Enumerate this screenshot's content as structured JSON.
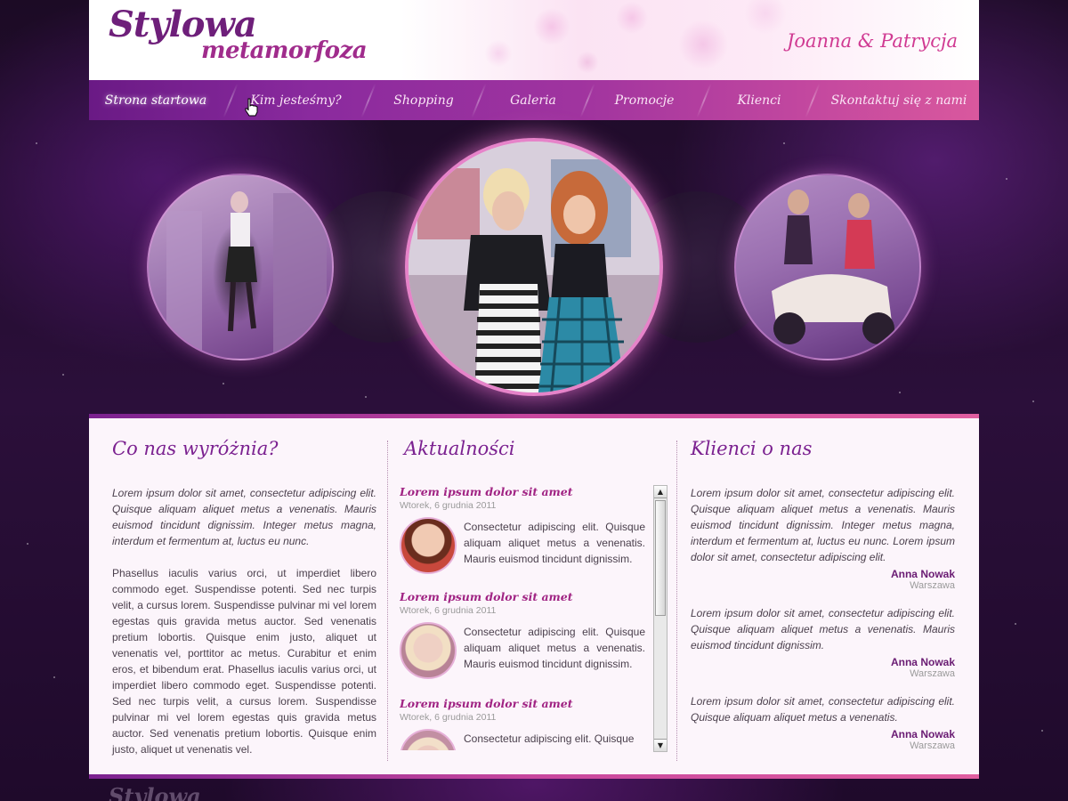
{
  "header": {
    "logo_line1": "Stylowa",
    "logo_line2": "metamorfoza",
    "authors": "Joanna & Patrycja"
  },
  "nav": {
    "items": [
      {
        "label": "Strona startowa",
        "active": true
      },
      {
        "label": "Kim jesteśmy?"
      },
      {
        "label": "Shopping"
      },
      {
        "label": "Galeria"
      },
      {
        "label": "Promocje"
      },
      {
        "label": "Klienci"
      },
      {
        "label": "Skontaktuj się z nami"
      }
    ]
  },
  "columns": {
    "features": {
      "title": "Co nas wyróżnia?",
      "intro": "Lorem ipsum dolor sit amet, consectetur adipiscing elit. Quisque aliquam aliquet metus a venenatis. Mauris euismod tincidunt dignissim. Integer metus magna, interdum et fermentum at, luctus eu nunc.",
      "body": "Phasellus iaculis varius orci, ut imperdiet libero commodo eget. Suspendisse potenti. Sed nec turpis velit, a cursus lorem. Suspendisse pulvinar mi vel lorem egestas quis gravida metus auctor. Sed venenatis pretium lobortis. Quisque enim justo, aliquet ut venenatis vel, porttitor ac metus. Curabitur et enim eros, et bibendum erat. Phasellus iaculis varius orci, ut imperdiet libero commodo eget. Suspendisse potenti. Sed nec turpis velit, a cursus lorem. Suspendisse pulvinar mi vel lorem egestas quis gravida metus auctor. Sed venenatis pretium lobortis. Quisque enim justo, aliquet ut venenatis vel."
    },
    "news": {
      "title": "Aktualności",
      "items": [
        {
          "title": "Lorem ipsum dolor sit amet",
          "date": "Wtorek, 6 grudnia 2011",
          "text": "Consectetur adipiscing elit. Quisque aliquam aliquet metus a venenatis. Mauris euismod tincidunt dignissim."
        },
        {
          "title": "Lorem ipsum dolor sit amet",
          "date": "Wtorek, 6 grudnia 2011",
          "text": "Consectetur adipiscing elit. Quisque aliquam aliquet metus a venenatis. Mauris euismod tincidunt dignissim."
        },
        {
          "title": "Lorem ipsum dolor sit amet",
          "date": "Wtorek, 6 grudnia 2011",
          "text": "Consectetur adipiscing elit. Quisque"
        }
      ]
    },
    "clients": {
      "title": "Klienci o nas",
      "items": [
        {
          "text": "Lorem ipsum dolor sit amet, consectetur adipiscing elit. Quisque aliquam aliquet metus a venenatis. Mauris euismod tincidunt dignissim. Integer metus magna, interdum et fermentum at, luctus eu nunc. Lorem ipsum dolor sit amet, consectetur adipiscing elit.",
          "name": "Anna Nowak",
          "city": "Warszawa"
        },
        {
          "text": "Lorem ipsum dolor sit amet, consectetur adipiscing elit. Quisque aliquam aliquet metus a venenatis. Mauris euismod tincidunt dignissim.",
          "name": "Anna Nowak",
          "city": "Warszawa"
        },
        {
          "text": "Lorem ipsum dolor sit amet, consectetur adipiscing elit. Quisque aliquam aliquet metus a venenatis.",
          "name": "Anna Nowak",
          "city": "Warszawa"
        }
      ]
    }
  },
  "footer": {
    "logo": "Stylowa"
  },
  "colors": {
    "brand_purple": "#7b2190",
    "brand_pink": "#d03a92",
    "nav_start": "#6a1a85",
    "nav_end": "#d9589e"
  }
}
